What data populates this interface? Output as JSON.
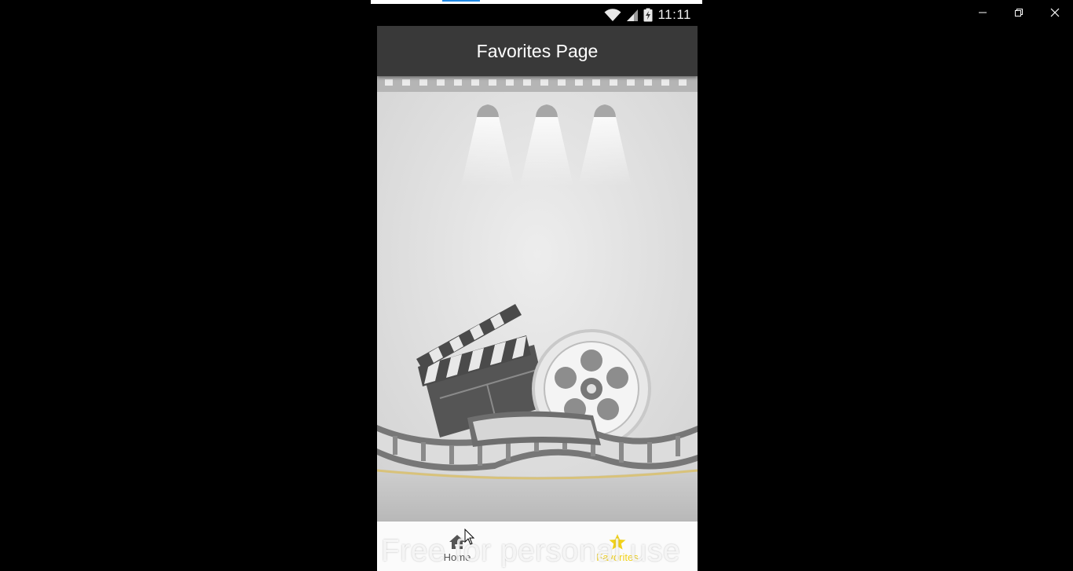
{
  "app": {
    "title": "Favorites Page"
  },
  "status_bar": {
    "time": "11:11",
    "icons": [
      "wifi-icon",
      "signal-icon",
      "battery-charging-icon"
    ]
  },
  "bottom_nav": {
    "items": [
      {
        "label": "Home",
        "icon": "home-icon",
        "active": false
      },
      {
        "label": "Favorites",
        "icon": "star-icon",
        "active": true,
        "active_color": "#f2d21b"
      }
    ]
  },
  "watermark": {
    "text": "Free for personal use"
  },
  "window_controls": {
    "icons": [
      "minimize-icon",
      "restore-icon",
      "close-icon"
    ]
  }
}
